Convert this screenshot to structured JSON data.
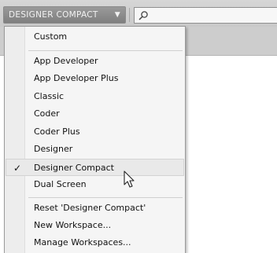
{
  "toolbar": {
    "workspace_label": "DESIGNER COMPACT",
    "caret": "▼",
    "search_placeholder": ""
  },
  "menu": {
    "group1": [
      {
        "label": "Custom"
      }
    ],
    "group2": [
      {
        "label": "App Developer"
      },
      {
        "label": "App Developer Plus"
      },
      {
        "label": "Classic"
      },
      {
        "label": "Coder"
      },
      {
        "label": "Coder Plus"
      },
      {
        "label": "Designer"
      },
      {
        "label": "Designer Compact",
        "checked": true
      },
      {
        "label": "Dual Screen"
      }
    ],
    "group3": [
      {
        "label": "Reset 'Designer Compact'"
      },
      {
        "label": "New Workspace..."
      },
      {
        "label": "Manage Workspaces..."
      }
    ],
    "check_glyph": "✓"
  },
  "icons": [
    "search-icon",
    "chevron-down-icon",
    "checkmark-icon",
    "mouse-pointer-icon"
  ]
}
